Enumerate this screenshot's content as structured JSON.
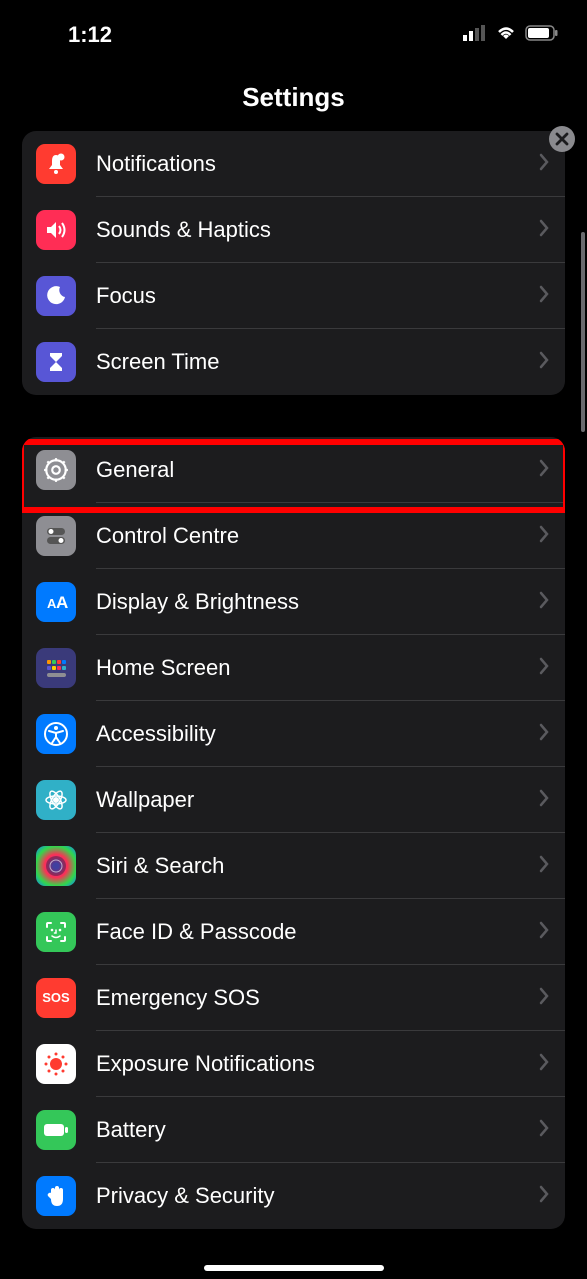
{
  "status": {
    "time": "1:12"
  },
  "header": {
    "title": "Settings"
  },
  "groups": [
    {
      "rows": [
        {
          "id": "notifications",
          "label": "Notifications",
          "icon": "bell-badge-icon",
          "iconClass": "ic-red"
        },
        {
          "id": "sounds",
          "label": "Sounds & Haptics",
          "icon": "speaker-wave-icon",
          "iconClass": "ic-red2"
        },
        {
          "id": "focus",
          "label": "Focus",
          "icon": "moon-icon",
          "iconClass": "ic-indigo"
        },
        {
          "id": "screentime",
          "label": "Screen Time",
          "icon": "hourglass-icon",
          "iconClass": "ic-indigo"
        }
      ]
    },
    {
      "rows": [
        {
          "id": "general",
          "label": "General",
          "icon": "gear-icon",
          "iconClass": "ic-gray",
          "highlighted": true
        },
        {
          "id": "controlcentre",
          "label": "Control Centre",
          "icon": "switches-icon",
          "iconClass": "ic-gray"
        },
        {
          "id": "display",
          "label": "Display & Brightness",
          "icon": "textsize-icon",
          "iconClass": "ic-blue"
        },
        {
          "id": "homescreen",
          "label": "Home Screen",
          "icon": "grid-icon",
          "iconClass": "ic-hs"
        },
        {
          "id": "accessibility",
          "label": "Accessibility",
          "icon": "accessibility-icon",
          "iconClass": "ic-blue"
        },
        {
          "id": "wallpaper",
          "label": "Wallpaper",
          "icon": "flower-icon",
          "iconClass": "ic-teal"
        },
        {
          "id": "siri",
          "label": "Siri & Search",
          "icon": "siri-icon",
          "iconClass": "ic-siri"
        },
        {
          "id": "faceid",
          "label": "Face ID & Passcode",
          "icon": "faceid-icon",
          "iconClass": "ic-green"
        },
        {
          "id": "sos",
          "label": "Emergency SOS",
          "icon": "sos-icon",
          "iconClass": "ic-red"
        },
        {
          "id": "exposure",
          "label": "Exposure Notifications",
          "icon": "exposure-icon",
          "iconClass": "ic-white"
        },
        {
          "id": "battery",
          "label": "Battery",
          "icon": "battery-icon",
          "iconClass": "ic-green"
        },
        {
          "id": "privacy",
          "label": "Privacy & Security",
          "icon": "hand-icon",
          "iconClass": "ic-blue"
        }
      ]
    }
  ]
}
